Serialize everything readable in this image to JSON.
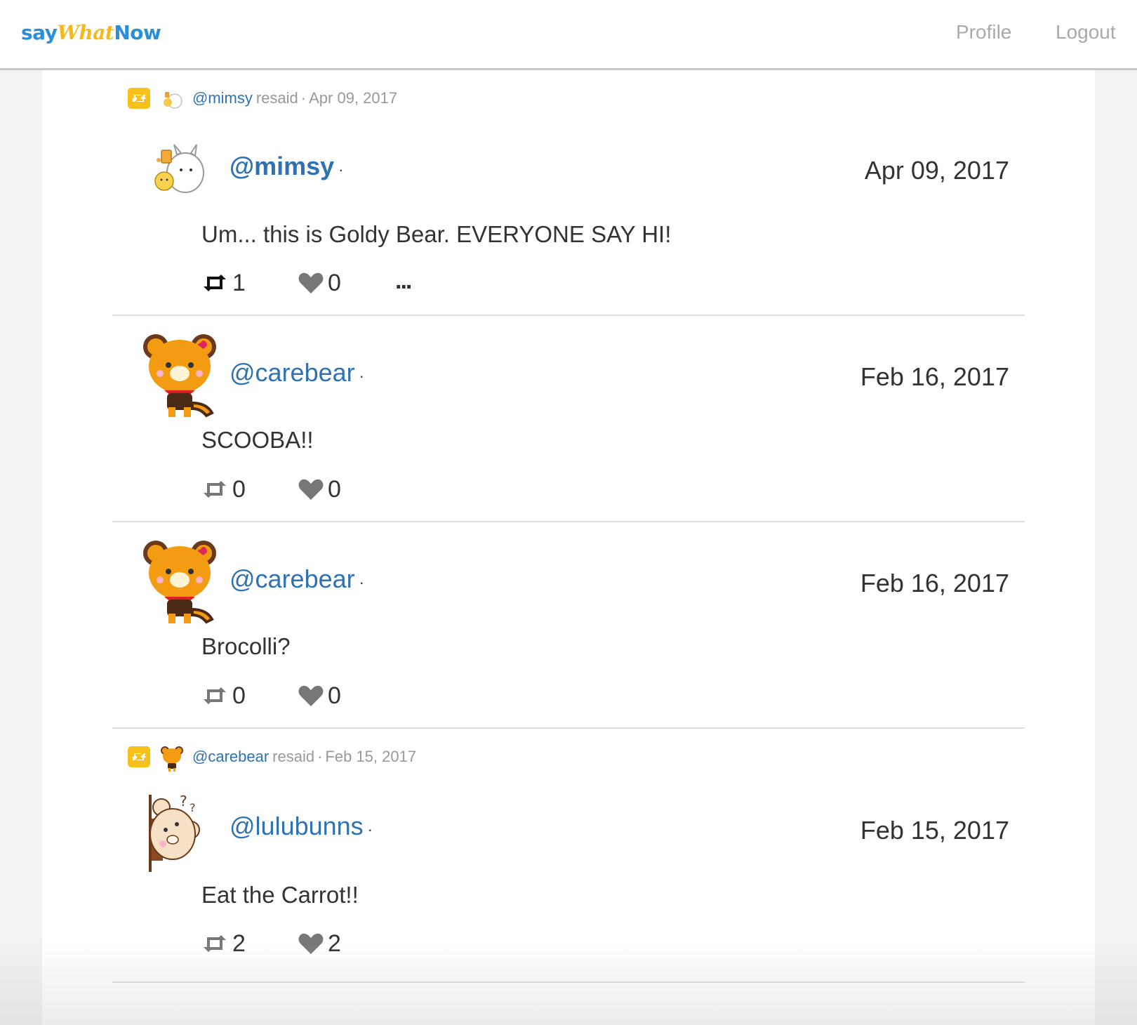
{
  "header": {
    "logo": {
      "say": "say",
      "what": "What",
      "now": "Now"
    },
    "nav": {
      "profile": "Profile",
      "logout": "Logout"
    }
  },
  "posts": [
    {
      "resaid": {
        "user": "@mimsy",
        "word": "resaid",
        "sep": "·",
        "date": "Apr 09, 2017",
        "avatar_icon": "bunny-chick-avatar"
      },
      "avatar_icon": "bunny-chick-avatar",
      "handle": "@mimsy",
      "dot": "·",
      "date": "Apr 09, 2017",
      "text": "Um... this is Goldy Bear. EVERYONE SAY HI!",
      "retweets": "1",
      "likes": "0",
      "more": "...",
      "retweeted_by_me": true
    },
    {
      "avatar_icon": "red-panda-avatar",
      "handle": "@carebear",
      "dot": "·",
      "date": "Feb 16, 2017",
      "text": "SCOOBA!!",
      "retweets": "0",
      "likes": "0"
    },
    {
      "avatar_icon": "red-panda-avatar",
      "handle": "@carebear",
      "dot": "·",
      "date": "Feb 16, 2017",
      "text": "Brocolli?",
      "retweets": "0",
      "likes": "0"
    },
    {
      "resaid": {
        "user": "@carebear",
        "word": "resaid",
        "sep": "·",
        "date": "Feb 15, 2017",
        "avatar_icon": "red-panda-avatar"
      },
      "avatar_icon": "peeking-bear-avatar",
      "handle": "@lulubunns",
      "dot": "·",
      "date": "Feb 15, 2017",
      "text": "Eat the Carrot!!",
      "retweets": "2",
      "likes": "2"
    }
  ],
  "colors": {
    "link": "#2f72b3",
    "accent_yellow": "#f8c01a",
    "muted": "#999999",
    "icon_gray": "#777777"
  }
}
